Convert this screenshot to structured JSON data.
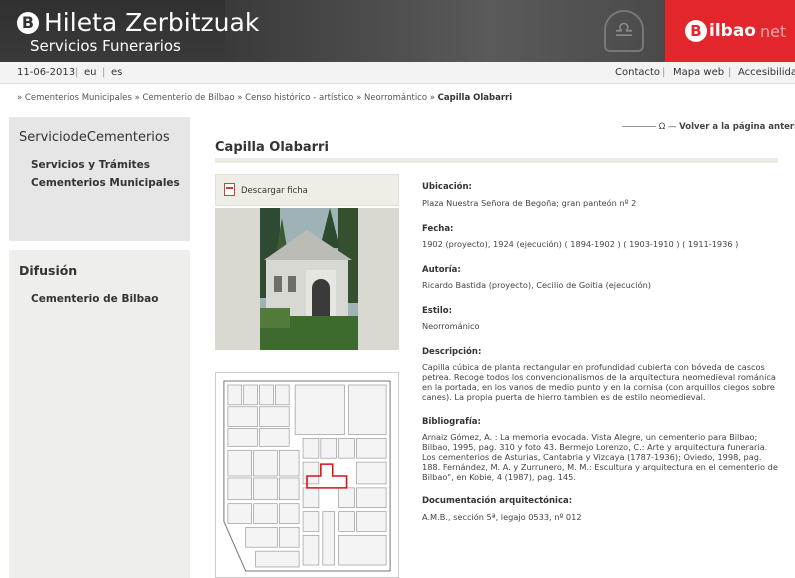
{
  "header": {
    "logo_letter": "B",
    "title": "Hileta Zerbitzuak",
    "subtitle": "Servicios Funerarios",
    "bilbao_letter": "B",
    "bilbao_text": "ilbao",
    "bilbao_net": "net",
    "accent_color": "#e3262c"
  },
  "topbar": {
    "date": "11-06-2013",
    "langs": [
      "eu",
      "es"
    ],
    "links": [
      "Contacto",
      "Mapa web",
      "Accesibilidad"
    ]
  },
  "breadcrumb": {
    "items": [
      "Cementerios Municipales",
      "Cementerio de Bilbao",
      "Censo histórico - artístico",
      "Neorromántico"
    ],
    "current": "Capilla Olabarri",
    "separator": "»"
  },
  "sidebar": {
    "section1_title_a": "Servicio",
    "section1_title_b": "deCementerios",
    "section1_items": [
      "Servicios y Trámites",
      "Cementerios Municipales"
    ],
    "section2_title": "Difusión",
    "section2_items": [
      "Cementerio de Bilbao"
    ]
  },
  "main": {
    "back_label": "Volver a la página anterior",
    "title": "Capilla Olabarri",
    "download_label": "Descargar ficha",
    "fields": [
      {
        "label": "Ubicación:",
        "value": "Plaza Nuestra Señora de Begoña; gran panteón nº 2"
      },
      {
        "label": "Fecha:",
        "value": "1902 (proyecto), 1924 (ejecución) ( 1894-1902 ) ( 1903-1910 ) ( 1911-1936 )"
      },
      {
        "label": "Autoría:",
        "value": "Ricardo Bastida (proyecto), Cecilio de Goitia (ejecución)"
      },
      {
        "label": "Estilo:",
        "value": "Neorrománico"
      },
      {
        "label": "Descripción:",
        "value": "Capilla cúbica de planta rectangular en profundidad cubierta con bóveda de cascos petrea. Recoge todos los convencionalismos de la arquitectura neomedieval románica en la portada, en los vanos de medio punto y en la cornisa (con arquillos ciegos sobre canes). La propia puerta de hierro tambien es de estilo neomedieval."
      },
      {
        "label": "Bibliografía:",
        "value": "Arnaiz Gómez, A. : La memoria evocada. Vista Alegre, un cementerio para Bilbao; Bilbao, 1995, pag. 310 y foto 43. Bermejo Lorenzo, C.: Arte y arquitectura funeraria. Los cementerios de Asturias, Cantabria y Vizcaya (1787-1936); Oviedo, 1998, pag. 188. Fernández, M. A. y Zurrunero, M. M.: Escultura y arquitectura en el cementerio de Bilbao\", en Kobie, 4 (1987), pag. 145."
      },
      {
        "label": "Documentación arquitectónica:",
        "value": "A.M.B., sección 5ª, legajo 0533, nº 012"
      }
    ]
  }
}
